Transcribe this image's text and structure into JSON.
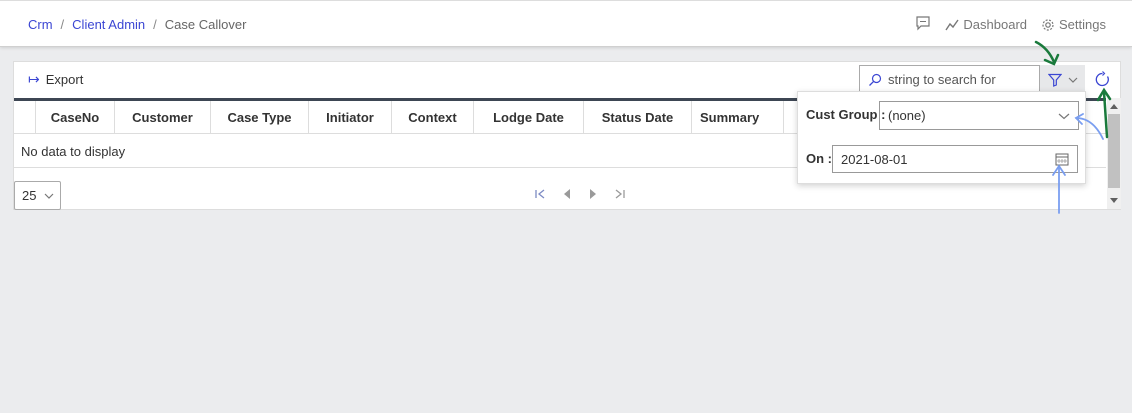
{
  "breadcrumb": {
    "items": [
      "Crm",
      "Client Admin"
    ],
    "separator": "/",
    "current": "Case Callover"
  },
  "topbar": {
    "dashboard_label": "Dashboard",
    "settings_label": "Settings"
  },
  "toolbar": {
    "export_label": "Export",
    "search_placeholder": "string to search for"
  },
  "grid": {
    "columns": [
      "CaseNo",
      "Customer",
      "Case Type",
      "Initiator",
      "Context",
      "Lodge Date",
      "Status Date",
      "Summary"
    ],
    "empty_text": "No data to display"
  },
  "pager": {
    "page_size": "25"
  },
  "filter_popup": {
    "cust_group_label": "Cust Group :",
    "cust_group_value": "(none)",
    "on_label": "On :",
    "on_value": "2021-08-01"
  },
  "colors": {
    "accent": "#3b46d3",
    "grid_header_bar": "#3d4653",
    "annotation_green": "#1a7a3c",
    "annotation_blue": "#7a9ef0"
  }
}
